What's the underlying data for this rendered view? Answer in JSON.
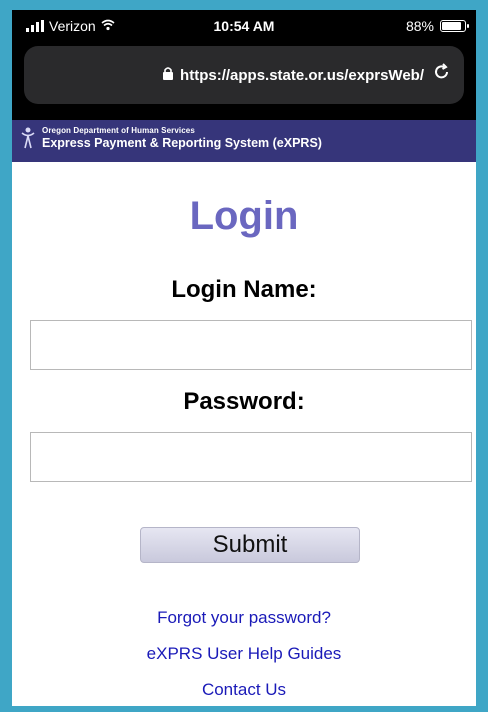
{
  "status_bar": {
    "carrier": "Verizon",
    "time": "10:54 AM",
    "battery": "88%"
  },
  "browser": {
    "url": "https://apps.state.or.us/exprsWeb/"
  },
  "banner": {
    "agency": "Oregon Department of Human Services",
    "system": "Express Payment & Reporting System (eXPRS)"
  },
  "page": {
    "title": "Login",
    "login_label": "Login Name:",
    "password_label": "Password:",
    "login_value": "",
    "password_value": "",
    "submit_label": "Submit"
  },
  "links": {
    "forgot": "Forgot your password?",
    "help": "eXPRS User Help Guides",
    "contact": "Contact Us"
  },
  "colors": {
    "frame": "#3fa6c6",
    "banner_bg": "#36357a",
    "title": "#6a67c0",
    "link": "#1a1ab8"
  }
}
